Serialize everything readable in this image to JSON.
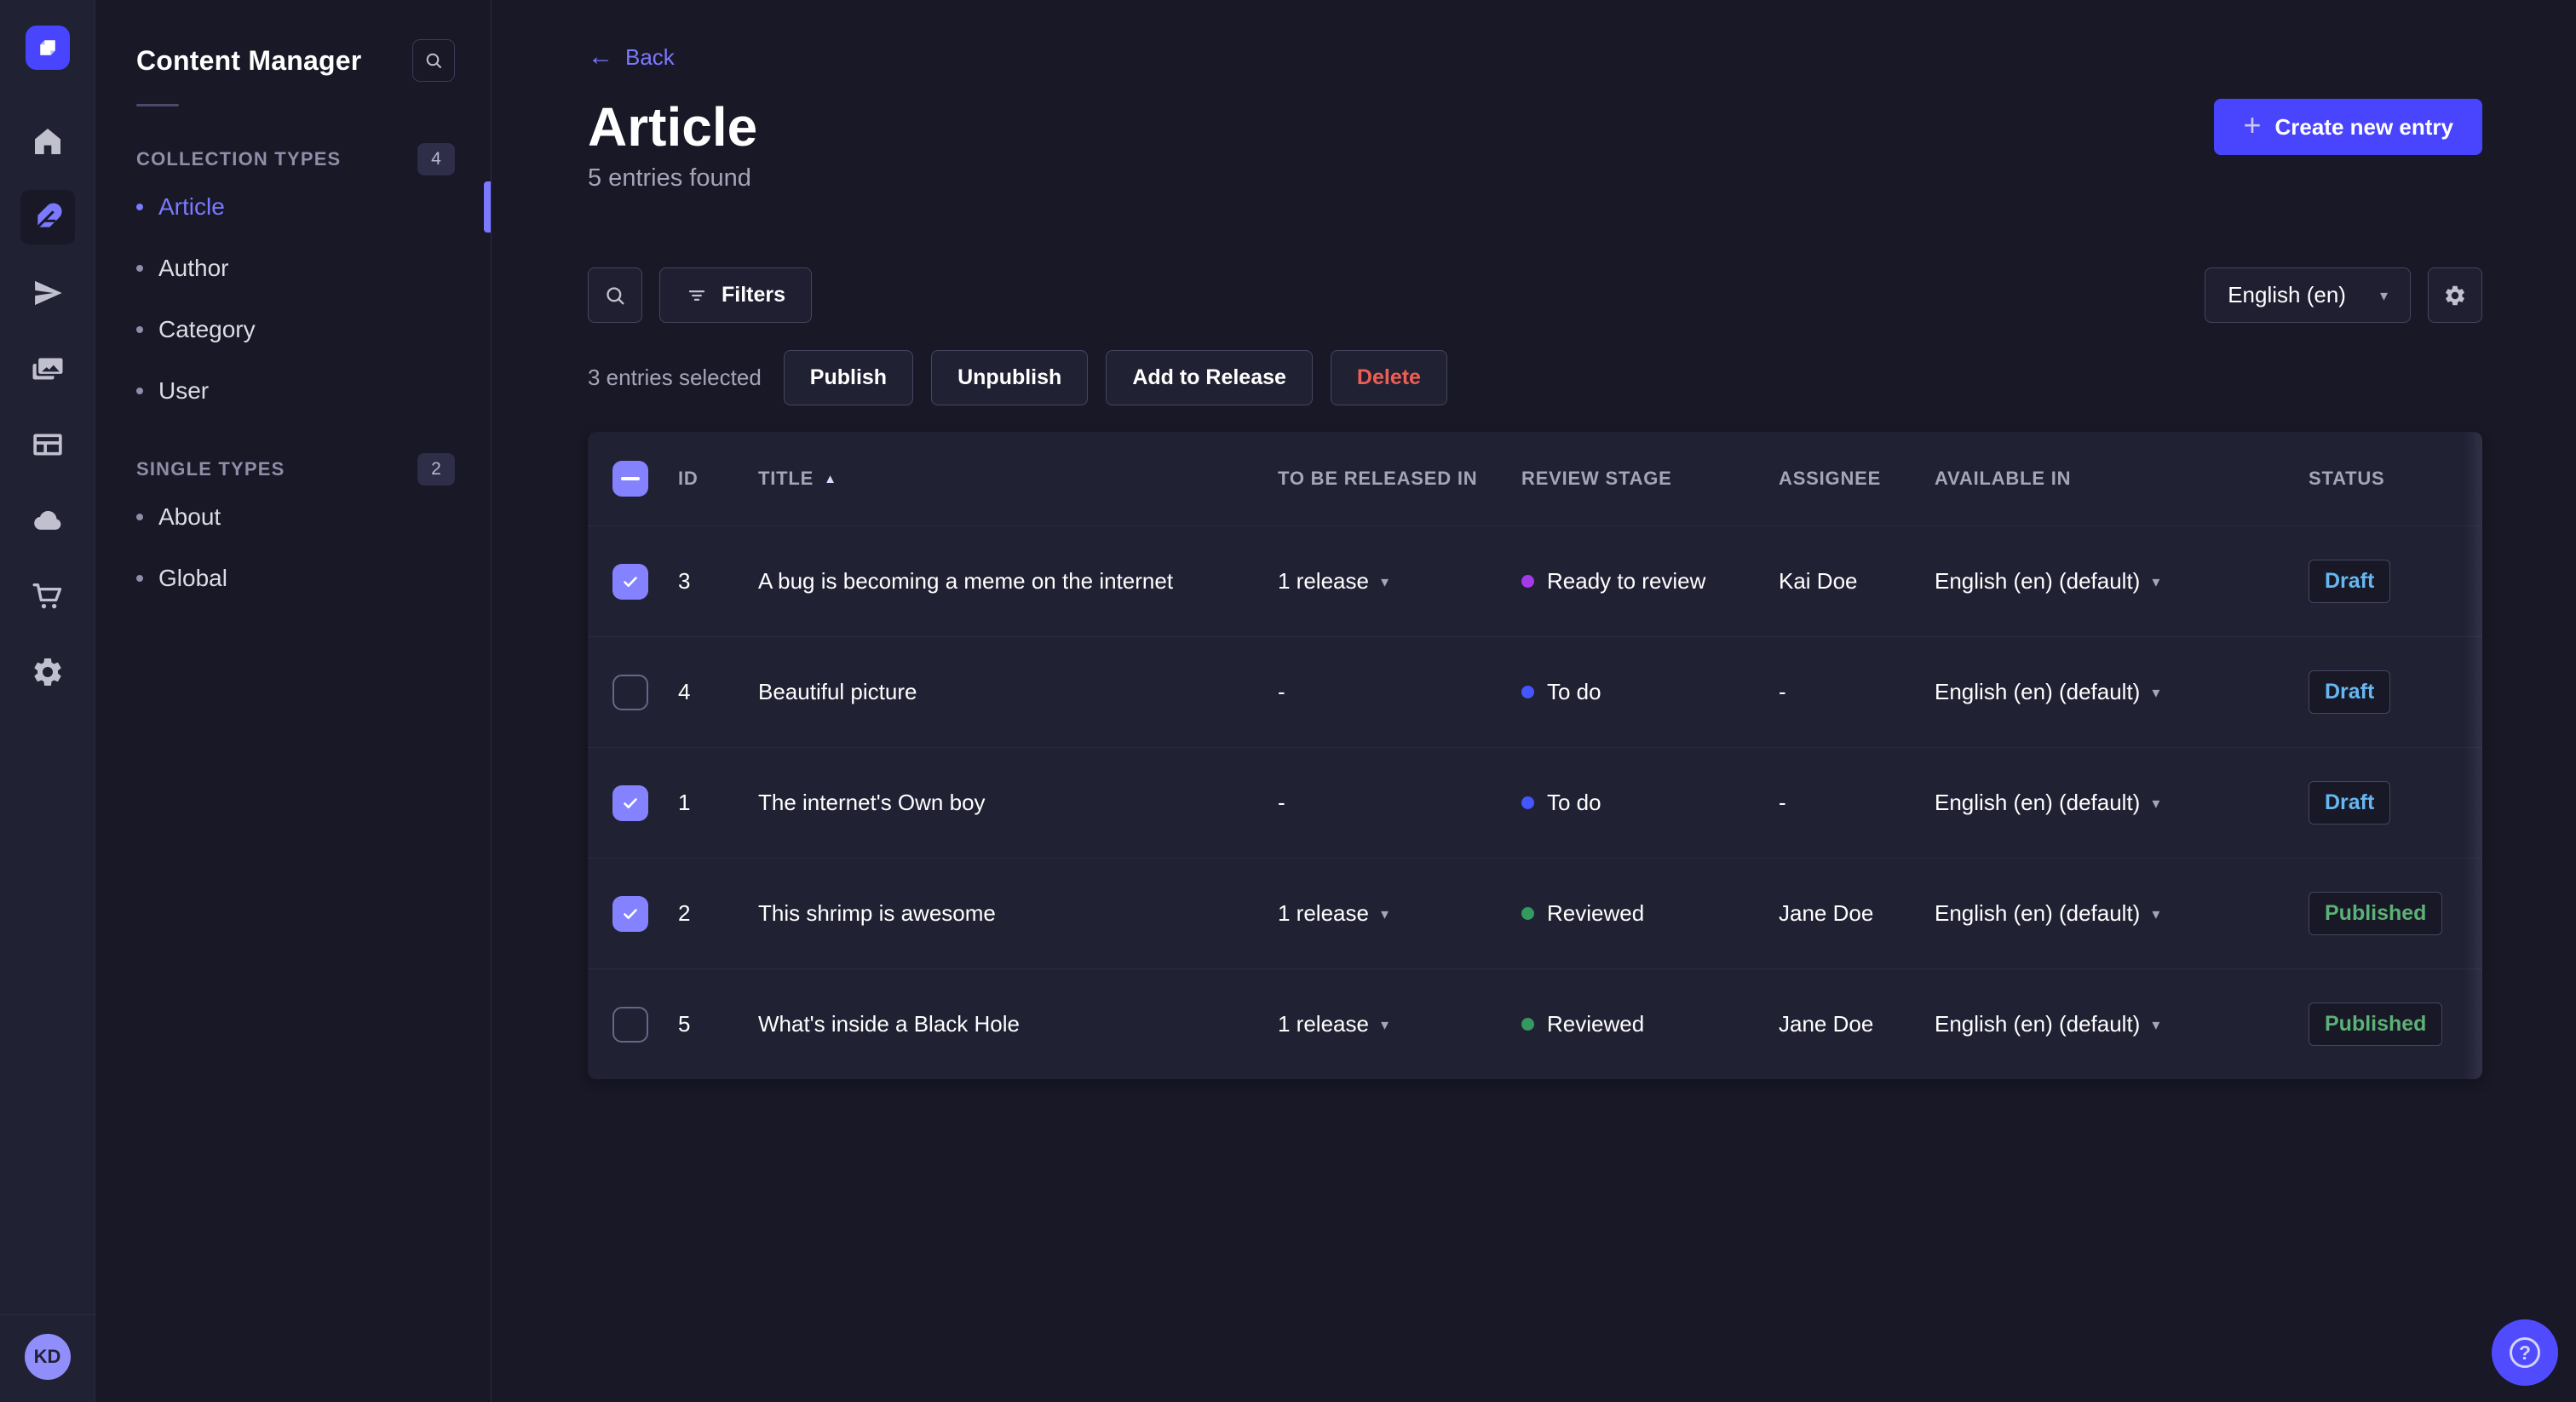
{
  "icons": {
    "back_arrow": "←",
    "plus": "+",
    "sort_asc": "▲",
    "chevron_down": "▾",
    "help": "?"
  },
  "colors": {
    "accent": "#4945ff",
    "link": "#7b79ff",
    "draft": "#66b7f1",
    "published": "#5cb176",
    "danger": "#ee5e52"
  },
  "rail": {
    "icons": [
      "home",
      "content-manager",
      "releases",
      "media-library",
      "content-type-builder",
      "deploy",
      "marketplace",
      "settings"
    ],
    "active_icon": "content-manager"
  },
  "user": {
    "initials": "KD"
  },
  "sidebar": {
    "title": "Content Manager",
    "sections": [
      {
        "label": "COLLECTION TYPES",
        "count": "4",
        "items": [
          {
            "label": "Article"
          },
          {
            "label": "Author"
          },
          {
            "label": "Category"
          },
          {
            "label": "User"
          }
        ]
      },
      {
        "label": "SINGLE TYPES",
        "count": "2",
        "items": [
          {
            "label": "About"
          },
          {
            "label": "Global"
          }
        ]
      }
    ]
  },
  "header": {
    "back_label": "Back",
    "title": "Article",
    "subtitle": "5 entries found",
    "create_label": "Create new entry"
  },
  "toolbar": {
    "filters_label": "Filters",
    "locale_value": "English (en)"
  },
  "selection": {
    "count_text": "3 entries selected",
    "publish_label": "Publish",
    "unpublish_label": "Unpublish",
    "add_to_release_label": "Add to Release",
    "delete_label": "Delete"
  },
  "table": {
    "headers": {
      "id": "ID",
      "title": "TITLE",
      "release": "TO BE RELEASED IN",
      "stage": "REVIEW STAGE",
      "assignee": "ASSIGNEE",
      "available": "AVAILABLE IN",
      "status": "STATUS"
    },
    "rows": [
      {
        "checked": true,
        "id": "3",
        "title": "A bug is becoming a meme on the internet",
        "release": "1 release",
        "stage": "Ready to review",
        "stage_color": "#a43ae8",
        "assignee": "Kai Doe",
        "locale": "English (en) (default)",
        "status": "Draft"
      },
      {
        "checked": false,
        "id": "4",
        "title": "Beautiful picture",
        "release": "-",
        "stage": "To do",
        "stage_color": "#4356ff",
        "assignee": "-",
        "locale": "English (en) (default)",
        "status": "Draft"
      },
      {
        "checked": true,
        "id": "1",
        "title": "The internet's Own boy",
        "release": "-",
        "stage": "To do",
        "stage_color": "#4356ff",
        "assignee": "-",
        "locale": "English (en) (default)",
        "status": "Draft"
      },
      {
        "checked": true,
        "id": "2",
        "title": "This shrimp is awesome",
        "release": "1 release",
        "stage": "Reviewed",
        "stage_color": "#339960",
        "assignee": "Jane Doe",
        "locale": "English (en) (default)",
        "status": "Published"
      },
      {
        "checked": false,
        "id": "5",
        "title": "What's inside a Black Hole",
        "release": "1 release",
        "stage": "Reviewed",
        "stage_color": "#339960",
        "assignee": "Jane Doe",
        "locale": "English (en) (default)",
        "status": "Published"
      }
    ]
  }
}
